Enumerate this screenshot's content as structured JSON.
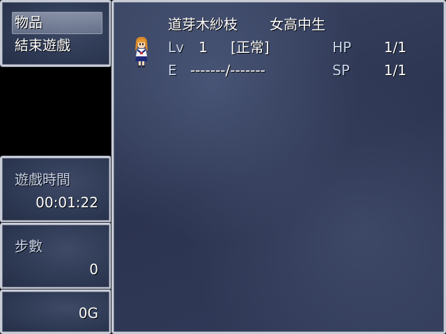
{
  "menu": {
    "items": [
      {
        "label": "物品"
      },
      {
        "label": "結束遊戲"
      }
    ]
  },
  "playtime": {
    "label": "遊戲時間",
    "value": "00:01:22"
  },
  "steps": {
    "label": "步數",
    "value": "0"
  },
  "gold": {
    "value": "0G"
  },
  "character": {
    "name": "道芽木紗枝",
    "class": "女高中生",
    "level_label": "Lv",
    "level": "1",
    "state": "[正常]",
    "hp_label": "HP",
    "hp": "1/1",
    "exp_label": "E",
    "exp": "-------/-------",
    "sp_label": "SP",
    "sp": "1/1",
    "sprite_icon": "schoolgirl-sprite-icon"
  }
}
